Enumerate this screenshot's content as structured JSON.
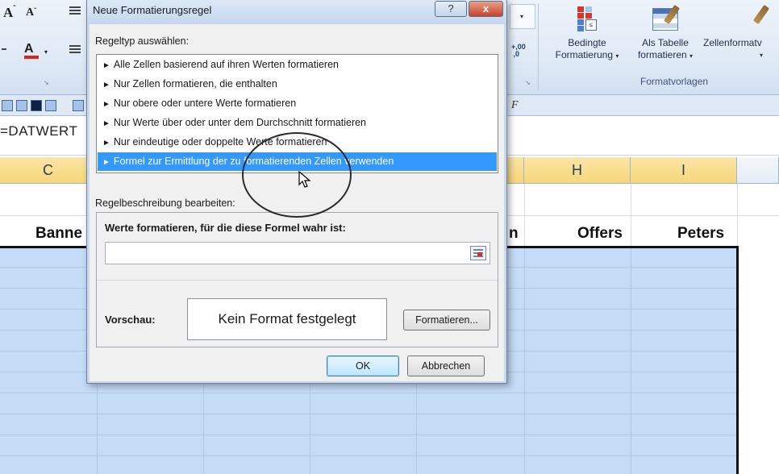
{
  "ribbon": {
    "font_grow": "A",
    "font_shrink": "A",
    "font_color": "A",
    "decimal_increase": "+,00\n,0",
    "conditional_formatting_label_1": "Bedingte",
    "conditional_formatting_label_2": "Formatierung",
    "as_table_label_1": "Als Tabelle",
    "as_table_label_2": "formatieren",
    "cell_styles_label": "Zellenformatv",
    "group_label": "Formatvorlagen",
    "dropdown_arrow": "▾"
  },
  "toolbar2": {
    "fx_letter": "F"
  },
  "formula_bar": {
    "text": "=DATWERT"
  },
  "grid": {
    "columns": [
      {
        "letter": "C",
        "selected": true
      },
      {
        "letter": "H",
        "selected": true
      },
      {
        "letter": "I",
        "selected": true
      }
    ],
    "headers": {
      "c": "Banne",
      "g_partial": "n",
      "h": "Offers",
      "i": "Peters"
    }
  },
  "dialog": {
    "title": "Neue Formatierungsregel",
    "help_button": "?",
    "close_button": "x",
    "rule_type_label": "Regeltyp auswählen:",
    "rule_types": [
      "Alle Zellen basierend auf ihren Werten formatieren",
      "Nur Zellen formatieren, die enthalten",
      "Nur obere oder untere Werte formatieren",
      "Nur Werte über oder unter dem Durchschnitt formatieren",
      "Nur eindeutige oder doppelte Werte formatieren",
      "Formel zur Ermittlung der zu formatierenden Zellen verwenden"
    ],
    "selected_rule_index": 5,
    "edit_description_label": "Regelbeschreibung bearbeiten:",
    "formula_label": "Werte formatieren, für die diese Formel wahr ist:",
    "formula_value": "",
    "preview_label": "Vorschau:",
    "preview_text": "Kein Format festgelegt",
    "format_button": "Formatieren...",
    "ok_button": "OK",
    "cancel_button": "Abbrechen"
  },
  "colors": {
    "selection_blue": "#3399ff",
    "selected_range": "#c5dcf6",
    "column_header_selected": "#f7d77a",
    "close_red": "#c7422c"
  }
}
